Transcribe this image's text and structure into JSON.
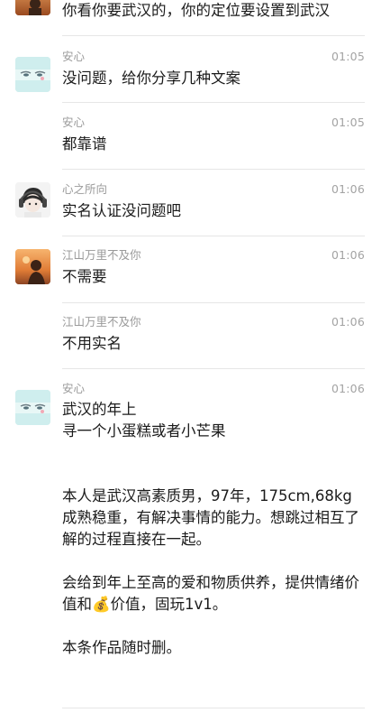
{
  "messages": [
    {
      "id": "m0",
      "avatar": "sunset-silhouette-avatar",
      "name": "",
      "time": "",
      "text": "你看你要武汉的，你的定位要设置到武汉"
    },
    {
      "id": "m1",
      "avatar": "anxin-avatar",
      "name": "安心",
      "time": "01:05",
      "text": "没问题，给你分享几种文案"
    },
    {
      "id": "m2",
      "avatar": "",
      "name": "安心",
      "time": "01:05",
      "text": "都靠谱"
    },
    {
      "id": "m3",
      "avatar": "anime-boy-headphones-avatar",
      "name": "心之所向",
      "time": "01:06",
      "text": "实名认证没问题吧"
    },
    {
      "id": "m4",
      "avatar": "sunset-silhouette-avatar",
      "name": "江山万里不及你",
      "time": "01:06",
      "text": "不需要"
    },
    {
      "id": "m5",
      "avatar": "",
      "name": "江山万里不及你",
      "time": "01:06",
      "text": "不用实名"
    },
    {
      "id": "m6",
      "avatar": "anxin-avatar",
      "name": "安心",
      "time": "01:06",
      "text": "武汉的年上\n寻一个小蛋糕或者小芒果\n\n\n本人是武汉高素质男，97年，175cm,68kg\n成熟稳重，有解决事情的能力。想跳过相互了解的过程直接在一起。\n\n会给到年上至高的爱和物质供养，提供情绪价\n值和💰价值，固玩1v1。\n\n本条作品随时删。"
    }
  ],
  "colors": {
    "name_text": "#9a9a9a",
    "time_text": "#a3a3a3",
    "message_text": "#1b1b1b",
    "divider": "#e6e6e6"
  }
}
